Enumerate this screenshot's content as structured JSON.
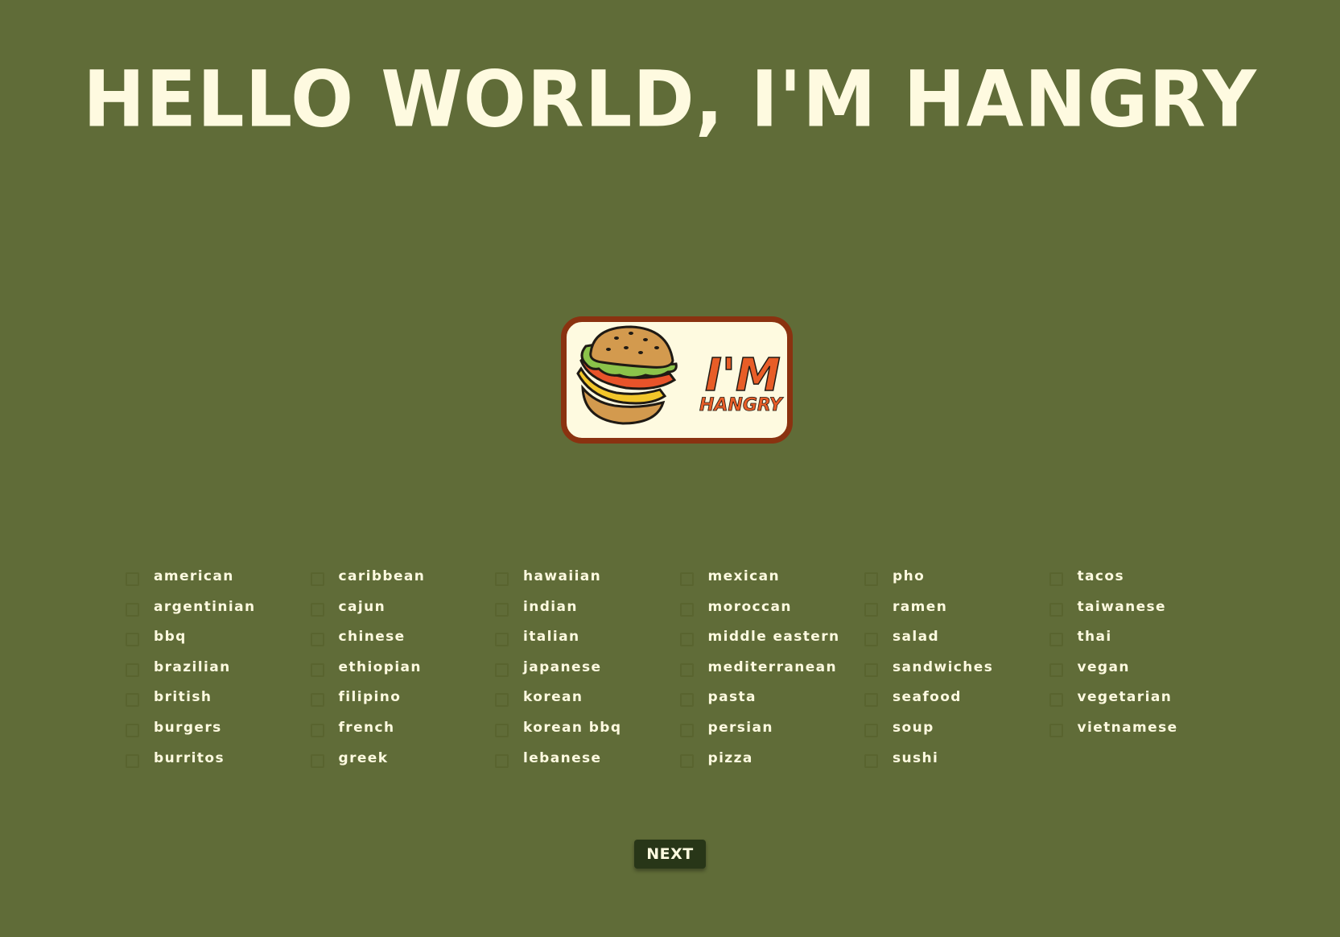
{
  "page": {
    "title": "HELLO WORLD, I'M HANGRY",
    "logo_text_top": "I'M",
    "logo_text_bottom": "HANGRY"
  },
  "cuisines": [
    [
      "American",
      "Argentinian",
      "BBQ",
      "Brazilian",
      "British",
      "Burgers",
      "Burritos"
    ],
    [
      "Caribbean",
      "Cajun",
      "Chinese",
      "Ethiopian",
      "Filipino",
      "French",
      "Greek"
    ],
    [
      "Hawaiian",
      "Indian",
      "Italian",
      "Japanese",
      "Korean",
      "Korean BBQ",
      "Lebanese"
    ],
    [
      "Mexican",
      "Moroccan",
      "Middle Eastern",
      "Mediterranean",
      "Pasta",
      "Persian",
      "Pizza"
    ],
    [
      "Pho",
      "Ramen",
      "Salad",
      "Sandwiches",
      "Seafood",
      "Soup",
      "Sushi"
    ],
    [
      "Tacos",
      "Taiwanese",
      "Thai",
      "Vegan",
      "Vegetarian",
      "Vietnamese"
    ]
  ],
  "actions": {
    "next_label": "NEXT"
  },
  "colors": {
    "background": "#606c38",
    "text": "#fefae0",
    "button": "#283618",
    "logo_border": "#8a3210",
    "logo_accent": "#e85d27"
  }
}
